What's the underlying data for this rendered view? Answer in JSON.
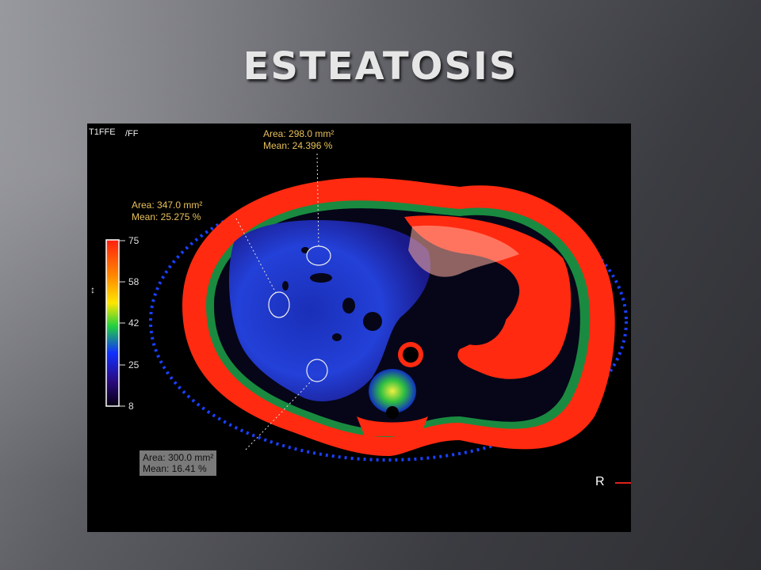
{
  "slide": {
    "title": "ESTEATOSIS"
  },
  "scan": {
    "sequence_label": "T1FFE",
    "map_label": "/FF",
    "orientation_marker": "R",
    "colorbar": {
      "ticks": [
        "75",
        "58",
        "42",
        "25",
        "8"
      ],
      "axis_glyph": "↕"
    },
    "rois": [
      {
        "area": "Area: 298.0 mm²",
        "mean": "Mean: 24.396 %"
      },
      {
        "area": "Area: 347.0 mm²",
        "mean": "Mean: 25.275 %"
      },
      {
        "area": "Area: 300.0 mm²",
        "mean": "Mean: 16.41 %"
      }
    ]
  },
  "colors": {
    "roi_label": "#e8c15a",
    "roi_box_bg": "#7a7a7a",
    "hot": "#ff2a10",
    "liver": "#1e3fd0",
    "marker": "#e02020"
  }
}
